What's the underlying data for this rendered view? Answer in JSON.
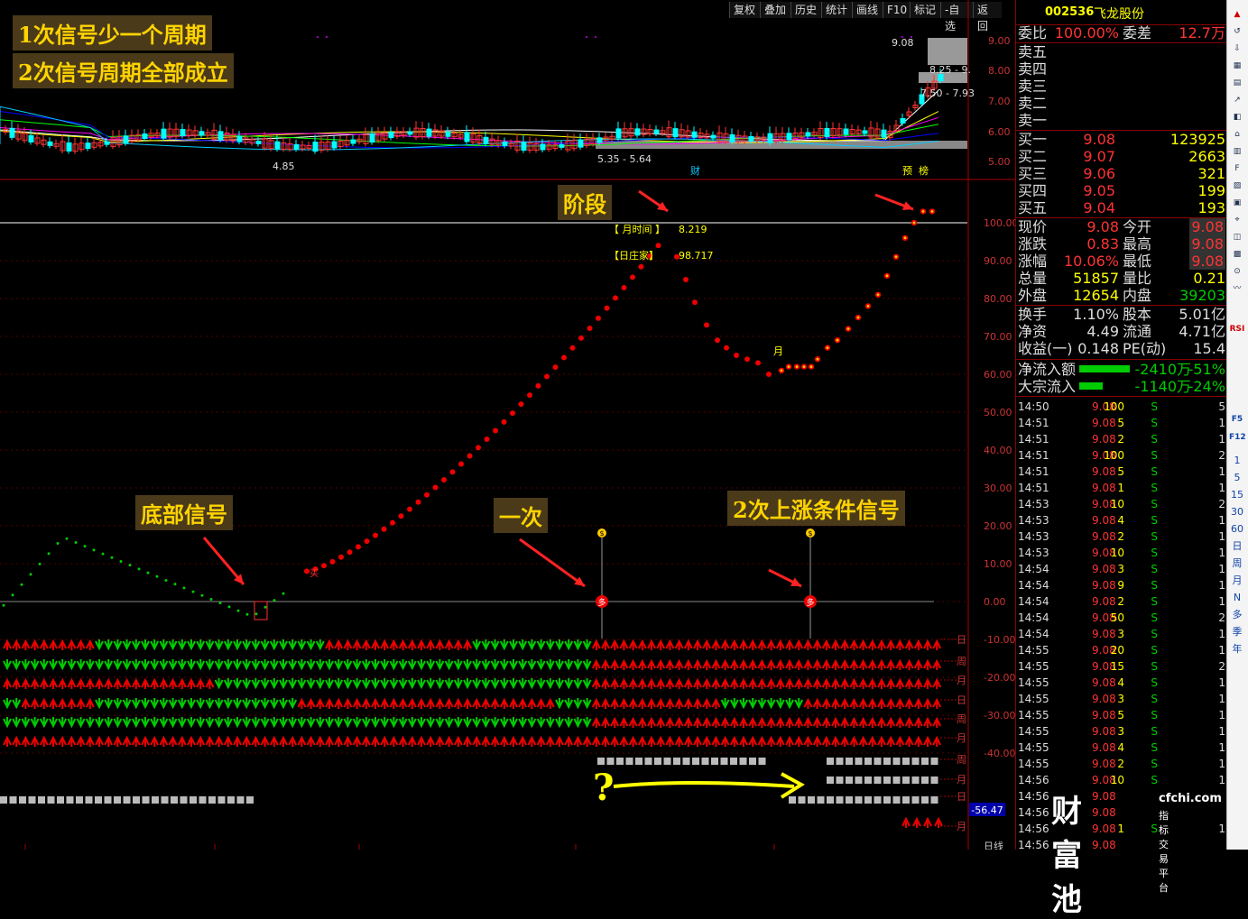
{
  "stock": {
    "code": "002536",
    "name": "飞龙股份"
  },
  "toolbar": {
    "buttons": [
      "复权",
      "叠加",
      "历史",
      "统计",
      "画线",
      "F10",
      "标记",
      "-自选",
      "返回"
    ]
  },
  "annotations": {
    "line1": "1次信号少一个周期",
    "line2": "2次信号周期全部成立",
    "stage": "阶段",
    "bottom_signal": "底部信号",
    "once": "一次",
    "twice": "2次上涨条件信号",
    "question": "?"
  },
  "price_axis": [
    "9.00",
    "8.00",
    "7.00",
    "6.00",
    "5.00"
  ],
  "price_labels": {
    "high": "9.08",
    "l1": "8.25 - 9.",
    "l2": "7.50 - 7.93",
    "low_label": "4.85",
    "range": "5.35 - 5.64",
    "cai": "财",
    "yu": "预",
    "bang": "榜"
  },
  "indicator_axis": [
    "100.00",
    "90.00",
    "80.00",
    "70.00",
    "60.00",
    "50.00",
    "40.00",
    "30.00",
    "20.00",
    "10.00",
    "0.00",
    "-10.00",
    "-20.00",
    "-30.00",
    "-40.00"
  ],
  "indicator_labels": {
    "month_time_label": "【 月时间 】",
    "month_time_value": "8.219",
    "day_dealer_label": "【日庄家】",
    "day_dealer_value": "98.717",
    "month_marker": "月",
    "buy_marker": "多",
    "jump_marker": "买",
    "bag_marker": "$"
  },
  "row_labels": [
    "日",
    "周",
    "月",
    "日",
    "周",
    "月",
    "周",
    "月",
    "日",
    "月"
  ],
  "bottom_value": "-56.47",
  "bottom_axis": "日线",
  "panel": {
    "weibi_label": "委比",
    "weibi_value": "100.00%",
    "weicha_label": "委差",
    "weicha_value": "12.7万",
    "asks": [
      {
        "label": "卖五"
      },
      {
        "label": "卖四"
      },
      {
        "label": "卖三"
      },
      {
        "label": "卖二"
      },
      {
        "label": "卖一"
      }
    ],
    "bids": [
      {
        "label": "买一",
        "price": "9.08",
        "vol": "123925"
      },
      {
        "label": "买二",
        "price": "9.07",
        "vol": "2663"
      },
      {
        "label": "买三",
        "price": "9.06",
        "vol": "321"
      },
      {
        "label": "买四",
        "price": "9.05",
        "vol": "199"
      },
      {
        "label": "买五",
        "price": "9.04",
        "vol": "193"
      }
    ],
    "quote": [
      {
        "l1": "现价",
        "v1": "9.08",
        "l2": "今开",
        "v2": "9.08"
      },
      {
        "l1": "涨跌",
        "v1": "0.83",
        "l2": "最高",
        "v2": "9.08"
      },
      {
        "l1": "涨幅",
        "v1": "10.06%",
        "l2": "最低",
        "v2": "9.08"
      },
      {
        "l1": "总量",
        "v1": "51857",
        "l2": "量比",
        "v2": "0.21"
      },
      {
        "l1": "外盘",
        "v1": "12654",
        "l2": "内盘",
        "v2": "39203"
      }
    ],
    "info": [
      {
        "l1": "换手",
        "v1": "1.10%",
        "l2": "股本",
        "v2": "5.01亿"
      },
      {
        "l1": "净资",
        "v1": "4.49",
        "l2": "流通",
        "v2": "4.71亿"
      },
      {
        "l1": "收益(一)",
        "v1": "0.148",
        "l2": "PE(动)",
        "v2": "15.4"
      }
    ],
    "flow": [
      {
        "label": "净流入额",
        "value": "-2410万",
        "pct": "-51%",
        "bar": 0.51
      },
      {
        "label": "大宗流入",
        "value": "-1140万",
        "pct": "-24%",
        "bar": 0.24
      }
    ],
    "ticks": [
      {
        "t": "14:50",
        "p": "9.08",
        "v": "100",
        "s": "S",
        "n": "5"
      },
      {
        "t": "14:51",
        "p": "9.08",
        "v": "5",
        "s": "S",
        "n": "1"
      },
      {
        "t": "14:51",
        "p": "9.08",
        "v": "2",
        "s": "S",
        "n": "1"
      },
      {
        "t": "14:51",
        "p": "9.08",
        "v": "100",
        "s": "S",
        "n": "2"
      },
      {
        "t": "14:51",
        "p": "9.08",
        "v": "5",
        "s": "S",
        "n": "1"
      },
      {
        "t": "14:51",
        "p": "9.08",
        "v": "1",
        "s": "S",
        "n": "1"
      },
      {
        "t": "14:53",
        "p": "9.08",
        "v": "10",
        "s": "S",
        "n": "2"
      },
      {
        "t": "14:53",
        "p": "9.08",
        "v": "4",
        "s": "S",
        "n": "1"
      },
      {
        "t": "14:53",
        "p": "9.08",
        "v": "2",
        "s": "S",
        "n": "1"
      },
      {
        "t": "14:53",
        "p": "9.08",
        "v": "10",
        "s": "S",
        "n": "1"
      },
      {
        "t": "14:54",
        "p": "9.08",
        "v": "3",
        "s": "S",
        "n": "1"
      },
      {
        "t": "14:54",
        "p": "9.08",
        "v": "9",
        "s": "S",
        "n": "1"
      },
      {
        "t": "14:54",
        "p": "9.08",
        "v": "2",
        "s": "S",
        "n": "1"
      },
      {
        "t": "14:54",
        "p": "9.08",
        "v": "50",
        "s": "S",
        "n": "2"
      },
      {
        "t": "14:54",
        "p": "9.08",
        "v": "3",
        "s": "S",
        "n": "1"
      },
      {
        "t": "14:55",
        "p": "9.08",
        "v": "20",
        "s": "S",
        "n": "1"
      },
      {
        "t": "14:55",
        "p": "9.08",
        "v": "15",
        "s": "S",
        "n": "2"
      },
      {
        "t": "14:55",
        "p": "9.08",
        "v": "4",
        "s": "S",
        "n": "1"
      },
      {
        "t": "14:55",
        "p": "9.08",
        "v": "3",
        "s": "S",
        "n": "1"
      },
      {
        "t": "14:55",
        "p": "9.08",
        "v": "5",
        "s": "S",
        "n": "1"
      },
      {
        "t": "14:55",
        "p": "9.08",
        "v": "3",
        "s": "S",
        "n": "1"
      },
      {
        "t": "14:55",
        "p": "9.08",
        "v": "4",
        "s": "S",
        "n": "1"
      },
      {
        "t": "14:55",
        "p": "9.08",
        "v": "2",
        "s": "S",
        "n": "1"
      },
      {
        "t": "14:56",
        "p": "9.08",
        "v": "10",
        "s": "S",
        "n": "1"
      },
      {
        "t": "14:56",
        "p": "9.08",
        "v": "",
        "s": "",
        "n": ""
      },
      {
        "t": "14:56",
        "p": "9.08",
        "v": "",
        "s": "",
        "n": ""
      },
      {
        "t": "14:56",
        "p": "9.08",
        "v": "1",
        "s": "S",
        "n": "1"
      },
      {
        "t": "14:56",
        "p": "9.08",
        "v": "",
        "s": "",
        "n": ""
      }
    ]
  },
  "watermark": {
    "brand": "财富池",
    "domain": "cfchi.com",
    "slogan": "指标交易平台"
  },
  "sidebar": {
    "labels": [
      "1",
      "5",
      "15",
      "30",
      "60",
      "日",
      "周",
      "月",
      "N",
      "多",
      "季",
      "年"
    ],
    "icons": [
      "RSI",
      "F5",
      "F12"
    ]
  }
}
